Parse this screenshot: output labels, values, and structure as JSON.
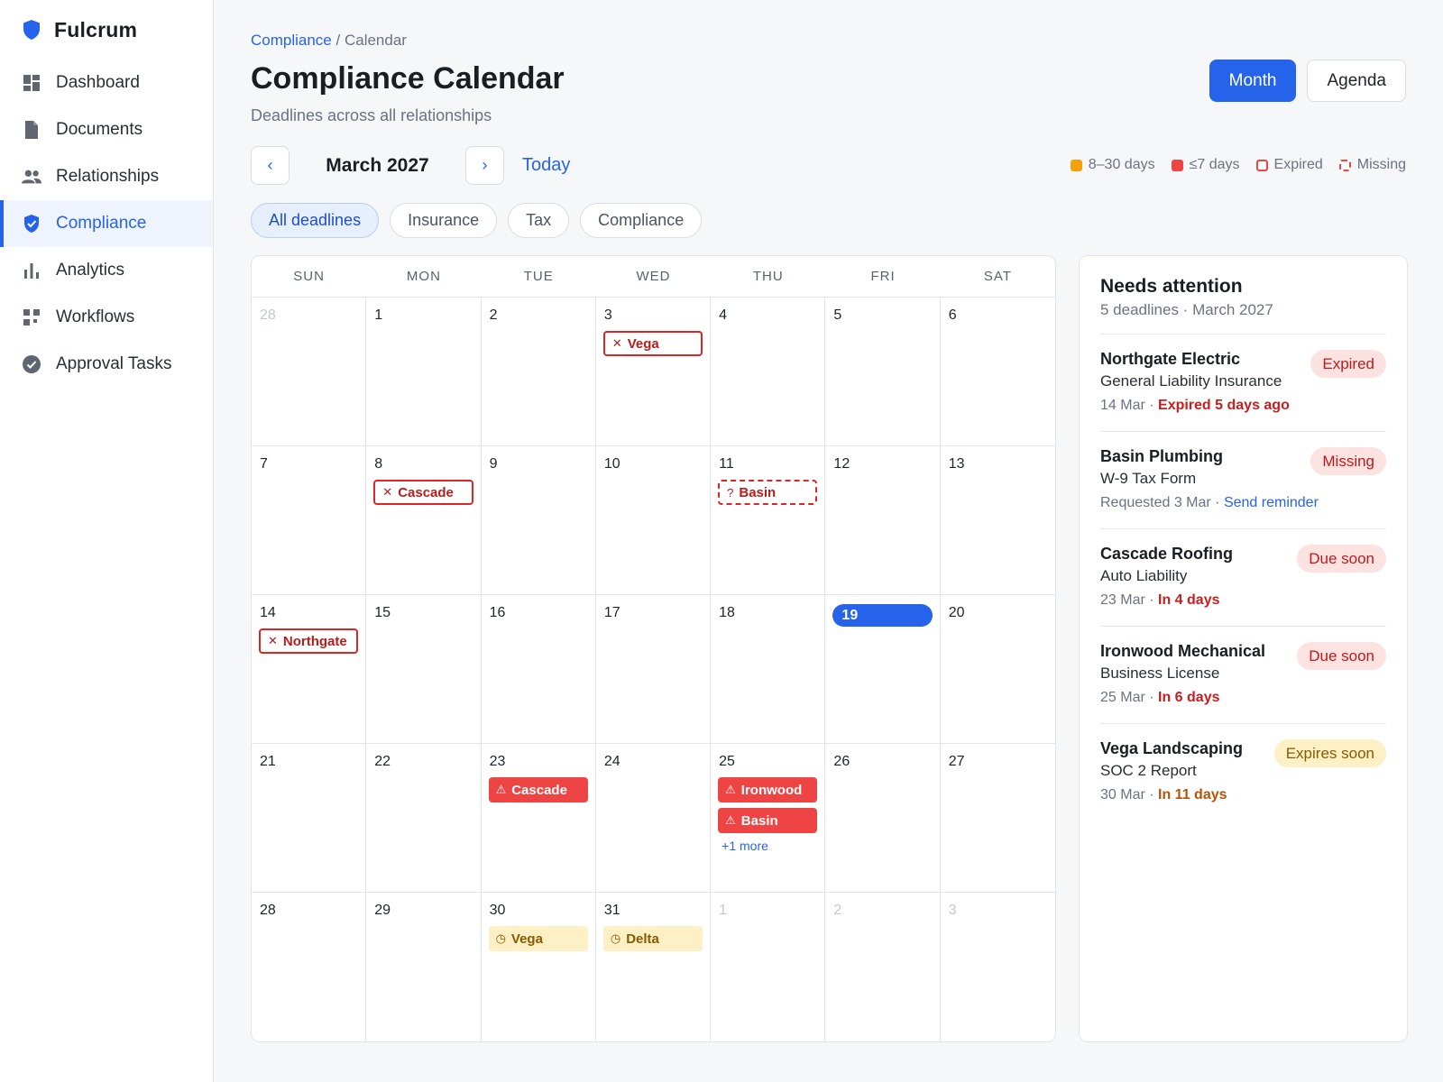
{
  "brand": {
    "name": "Fulcrum"
  },
  "sidebar": {
    "items": [
      {
        "label": "Dashboard",
        "icon": "dashboard-icon"
      },
      {
        "label": "Documents",
        "icon": "document-icon"
      },
      {
        "label": "Relationships",
        "icon": "people-icon"
      },
      {
        "label": "Compliance",
        "icon": "shield-check-icon",
        "active": true
      },
      {
        "label": "Analytics",
        "icon": "bar-chart-icon"
      },
      {
        "label": "Workflows",
        "icon": "workflow-icon"
      },
      {
        "label": "Approval Tasks",
        "icon": "check-circle-icon"
      }
    ]
  },
  "breadcrumb": {
    "parent": "Compliance",
    "separator": "/",
    "current": "Calendar"
  },
  "page": {
    "title": "Compliance Calendar",
    "subtitle": "Deadlines across all relationships"
  },
  "view_toggle": {
    "month": "Month",
    "agenda": "Agenda",
    "selected": "Month"
  },
  "month_nav": {
    "prev": "‹",
    "next": "›",
    "label": "March 2027",
    "today": "Today"
  },
  "legend": [
    {
      "label": "8–30 days",
      "color": "#f5a20a"
    },
    {
      "label": "≤7 days",
      "color": "#ef4444"
    },
    {
      "label": "Expired",
      "color": "#ef4444"
    },
    {
      "label": "Missing",
      "color": "#ef4444"
    }
  ],
  "filters": [
    {
      "label": "All deadlines",
      "active": true
    },
    {
      "label": "Insurance"
    },
    {
      "label": "Tax"
    },
    {
      "label": "Compliance"
    }
  ],
  "calendar": {
    "weekdays": [
      "SUN",
      "MON",
      "TUE",
      "WED",
      "THU",
      "FRI",
      "SAT"
    ],
    "days": [
      {
        "n": "28",
        "muted": true
      },
      {
        "n": "1"
      },
      {
        "n": "2"
      },
      {
        "n": "3",
        "events": [
          {
            "label": "Vega",
            "kind": "expired"
          }
        ]
      },
      {
        "n": "4"
      },
      {
        "n": "5"
      },
      {
        "n": "6"
      },
      {
        "n": "7"
      },
      {
        "n": "8",
        "events": [
          {
            "label": "Cascade",
            "kind": "expired"
          }
        ]
      },
      {
        "n": "9"
      },
      {
        "n": "10"
      },
      {
        "n": "11",
        "events": [
          {
            "label": "Basin",
            "kind": "missing"
          }
        ]
      },
      {
        "n": "12"
      },
      {
        "n": "13"
      },
      {
        "n": "14",
        "events": [
          {
            "label": "Northgate",
            "kind": "expired"
          }
        ]
      },
      {
        "n": "15"
      },
      {
        "n": "16"
      },
      {
        "n": "17"
      },
      {
        "n": "18"
      },
      {
        "n": "19",
        "today": true
      },
      {
        "n": "20"
      },
      {
        "n": "21"
      },
      {
        "n": "22"
      },
      {
        "n": "23",
        "events": [
          {
            "label": "Cascade",
            "kind": "urgent"
          }
        ]
      },
      {
        "n": "24"
      },
      {
        "n": "25",
        "events": [
          {
            "label": "Ironwood",
            "kind": "urgent"
          },
          {
            "label": "Basin",
            "kind": "urgent"
          }
        ],
        "more": "+1 more"
      },
      {
        "n": "26"
      },
      {
        "n": "27"
      },
      {
        "n": "28"
      },
      {
        "n": "29"
      },
      {
        "n": "30",
        "events": [
          {
            "label": "Vega",
            "kind": "soon"
          }
        ]
      },
      {
        "n": "31",
        "events": [
          {
            "label": "Delta",
            "kind": "soon"
          }
        ]
      },
      {
        "n": "1",
        "muted": true
      },
      {
        "n": "2",
        "muted": true
      },
      {
        "n": "3",
        "muted": true
      }
    ]
  },
  "panel": {
    "title": "Needs attention",
    "subtitle": "5 deadlines · March 2027",
    "items": [
      {
        "name": "Northgate Electric",
        "doc": "General Liability Insurance",
        "date": "14 Mar",
        "sep": " · ",
        "status": "Expired 5 days ago",
        "status_tone": "red",
        "badge": "Expired",
        "badge_tone": "red"
      },
      {
        "name": "Basin Plumbing",
        "doc": "W-9 Tax Form",
        "date": "Requested 3 Mar",
        "sep": " · ",
        "action": "Send reminder",
        "badge": "Missing",
        "badge_tone": "red"
      },
      {
        "name": "Cascade Roofing",
        "doc": "Auto Liability",
        "date": "23 Mar",
        "sep": " · ",
        "status": "In 4 days",
        "status_tone": "red",
        "badge": "Due soon",
        "badge_tone": "red"
      },
      {
        "name": "Ironwood Mechanical",
        "doc": "Business License",
        "date": "25 Mar",
        "sep": " · ",
        "status": "In 6 days",
        "status_tone": "red",
        "badge": "Due soon",
        "badge_tone": "red"
      },
      {
        "name": "Vega Landscaping",
        "doc": "SOC 2 Report",
        "date": "30 Mar",
        "sep": " · ",
        "status": "In 11 days",
        "status_tone": "amber",
        "badge": "Expires soon",
        "badge_tone": "amber"
      }
    ]
  },
  "colors": {
    "accent": "#2563eb",
    "danger": "#ef4444",
    "warning": "#f5a20a"
  }
}
